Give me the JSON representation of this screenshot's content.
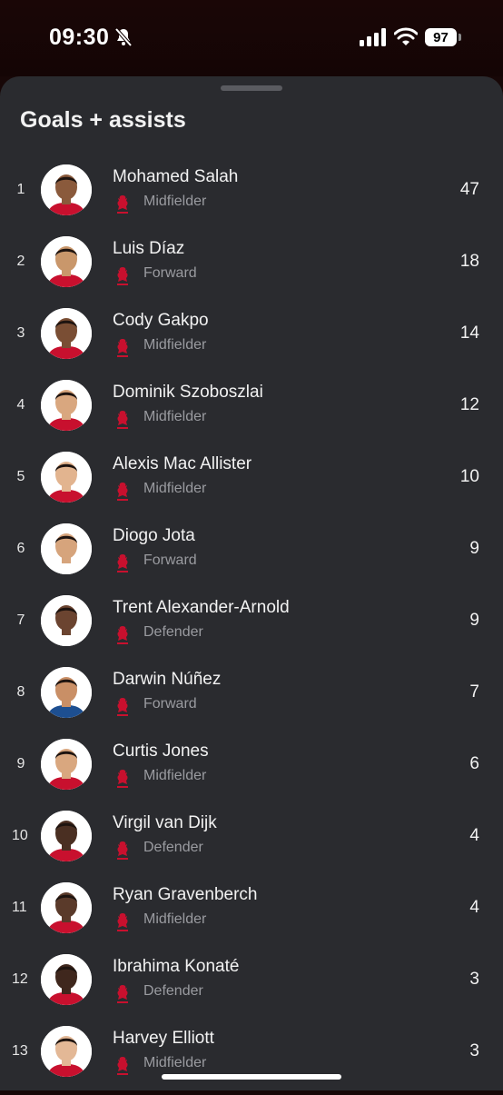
{
  "status_bar": {
    "time": "09:30",
    "battery": "97"
  },
  "sheet": {
    "title": "Goals + assists"
  },
  "players": [
    {
      "rank": "1",
      "name": "Mohamed Salah",
      "position": "Midfielder",
      "value": "47"
    },
    {
      "rank": "2",
      "name": "Luis Díaz",
      "position": "Forward",
      "value": "18"
    },
    {
      "rank": "3",
      "name": "Cody Gakpo",
      "position": "Midfielder",
      "value": "14"
    },
    {
      "rank": "4",
      "name": "Dominik Szoboszlai",
      "position": "Midfielder",
      "value": "12"
    },
    {
      "rank": "5",
      "name": "Alexis Mac Allister",
      "position": "Midfielder",
      "value": "10"
    },
    {
      "rank": "6",
      "name": "Diogo Jota",
      "position": "Forward",
      "value": "9"
    },
    {
      "rank": "7",
      "name": "Trent Alexander-Arnold",
      "position": "Defender",
      "value": "9"
    },
    {
      "rank": "8",
      "name": "Darwin Núñez",
      "position": "Forward",
      "value": "7"
    },
    {
      "rank": "9",
      "name": "Curtis Jones",
      "position": "Midfielder",
      "value": "6"
    },
    {
      "rank": "10",
      "name": "Virgil van Dijk",
      "position": "Defender",
      "value": "4"
    },
    {
      "rank": "11",
      "name": "Ryan Gravenberch",
      "position": "Midfielder",
      "value": "4"
    },
    {
      "rank": "12",
      "name": "Ibrahima Konaté",
      "position": "Defender",
      "value": "3"
    },
    {
      "rank": "13",
      "name": "Harvey Elliott",
      "position": "Midfielder",
      "value": "3"
    }
  ],
  "colors": {
    "club_red": "#c8102e",
    "sheet_bg": "#2a2b2f",
    "secondary_text": "#9a9ba0"
  },
  "icons": {
    "club_crest": "liverbird-crest-icon",
    "silent": "bell-slash-icon"
  }
}
